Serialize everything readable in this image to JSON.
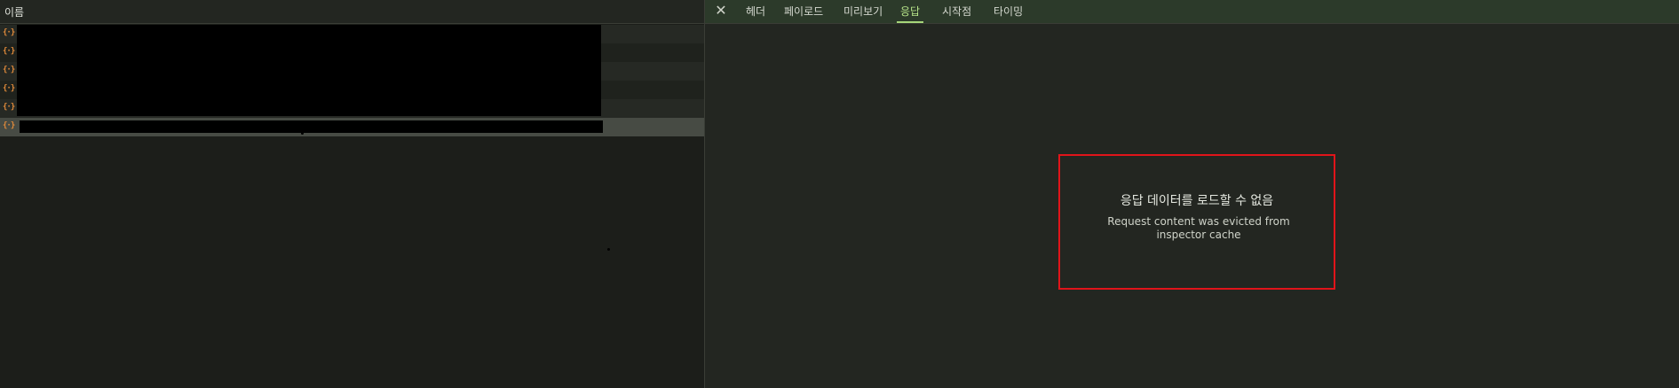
{
  "list": {
    "header_name": "이름",
    "rows": [
      {
        "icon": "{·}",
        "name": ""
      },
      {
        "icon": "{·}",
        "name": ""
      },
      {
        "icon": "{·}",
        "name": ""
      },
      {
        "icon": "{·}",
        "name": ""
      },
      {
        "icon": "{·}",
        "name": ""
      },
      {
        "icon": "{·}",
        "name": ""
      }
    ]
  },
  "details": {
    "close_icon": "✕",
    "tabs": [
      "헤더",
      "페이로드",
      "미리보기",
      "응답",
      "시작점",
      "타이밍"
    ],
    "active_tab": "응답",
    "empty_title": "응답 데이터를 로드할 수 없음",
    "empty_message": "Request content was evicted from inspector cache"
  },
  "colors": {
    "accent_tab": "#b7e48a",
    "highlight_border": "#e0141a",
    "json_icon": "#e08a3a"
  }
}
